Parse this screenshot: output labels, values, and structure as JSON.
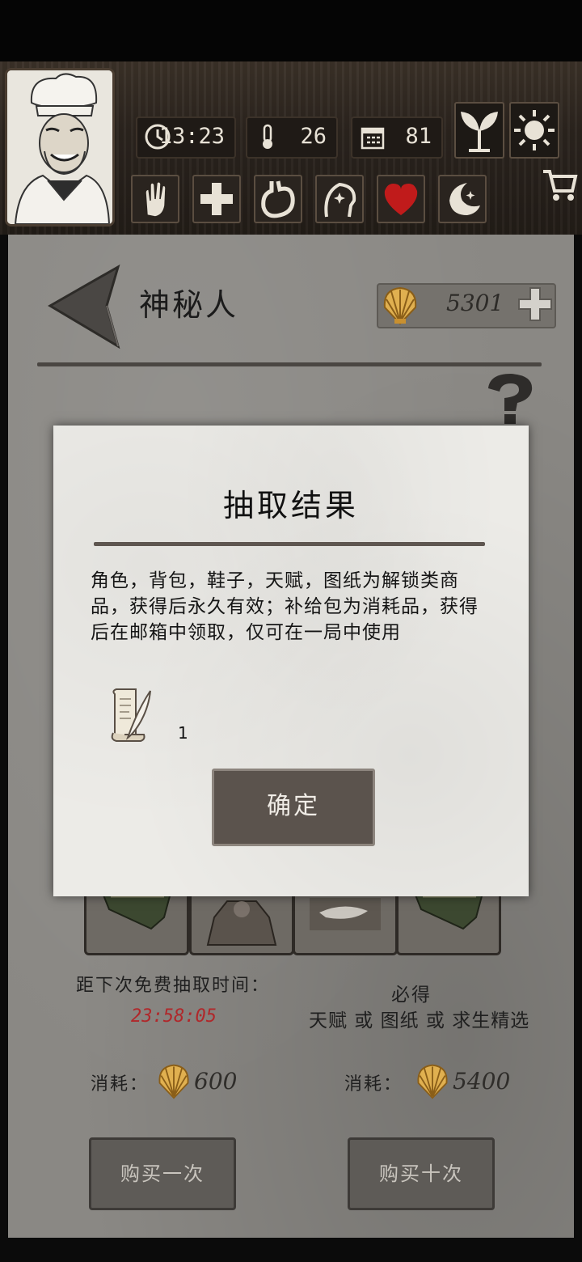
{
  "status": {
    "time": "13:23",
    "temperature": "26",
    "days": "81"
  },
  "icons": {
    "clock": "clock-icon",
    "thermometer": "thermometer-icon",
    "calendar": "calendar-icon",
    "sprout": "sprout-icon",
    "sun": "sun-icon",
    "cart": "cart-icon",
    "hand": "hand-icon",
    "health": "plus-icon",
    "stomach": "stomach-icon",
    "mind": "head-sparkle-icon",
    "heart": "heart-icon",
    "moon": "moon-icon",
    "back": "back-arrow-icon",
    "shell": "shell-icon",
    "help": "question-icon",
    "scroll": "scroll-quill-icon"
  },
  "header": {
    "title": "神秘人",
    "currency_amount": "5301"
  },
  "draw": {
    "free_timer_label": "距下次免费抽取时间：",
    "free_timer_value": "23:58:05",
    "guarantee_title": "必得",
    "guarantee_desc": "天赋 或 图纸 或 求生精选",
    "cost_label_single": "消耗：",
    "cost_single": "600",
    "cost_label_ten": "消耗：",
    "cost_ten": "5400",
    "buy_once": "购买一次",
    "buy_ten": "购买十次"
  },
  "modal": {
    "title": "抽取结果",
    "line1": "角色，背包，鞋子，天赋，图纸为解锁类商",
    "line2": "品，获得后永久有效；补给包为消耗品，获得",
    "line3": "后在邮箱中领取，仅可在一局中使用",
    "reward_qty": "1",
    "confirm": "确定"
  },
  "colors": {
    "timer_red": "#b0272a",
    "heart_red": "#c01b1b",
    "shell_gold": "#e0b050"
  }
}
